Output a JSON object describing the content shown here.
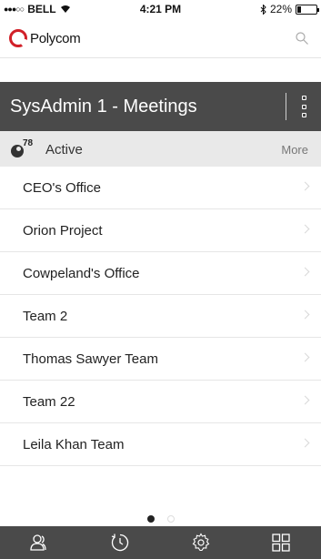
{
  "status_bar": {
    "carrier": "BELL",
    "signal_dots": "●●●○○",
    "time": "4:21 PM",
    "battery": "22%",
    "battery_level": 0.22
  },
  "brand": {
    "name": "Polycom",
    "accent_color": "#d12028"
  },
  "header": {
    "title": "SysAdmin 1 - Meetings"
  },
  "active_section": {
    "count": "78",
    "label": "Active",
    "more_label": "More"
  },
  "meetings": [
    {
      "label": "CEO's Office"
    },
    {
      "label": "Orion Project"
    },
    {
      "label": "Cowpeland's Office"
    },
    {
      "label": "Team 2"
    },
    {
      "label": "Thomas Sawyer Team"
    },
    {
      "label": "Team 22"
    },
    {
      "label": "Leila Khan Team"
    }
  ],
  "pager": {
    "current_page": 1,
    "page_count": 2
  },
  "tab_bar": {
    "tabs": [
      {
        "icon": "contacts-icon"
      },
      {
        "icon": "history-icon"
      },
      {
        "icon": "settings-icon"
      },
      {
        "icon": "grid-icon"
      }
    ]
  }
}
